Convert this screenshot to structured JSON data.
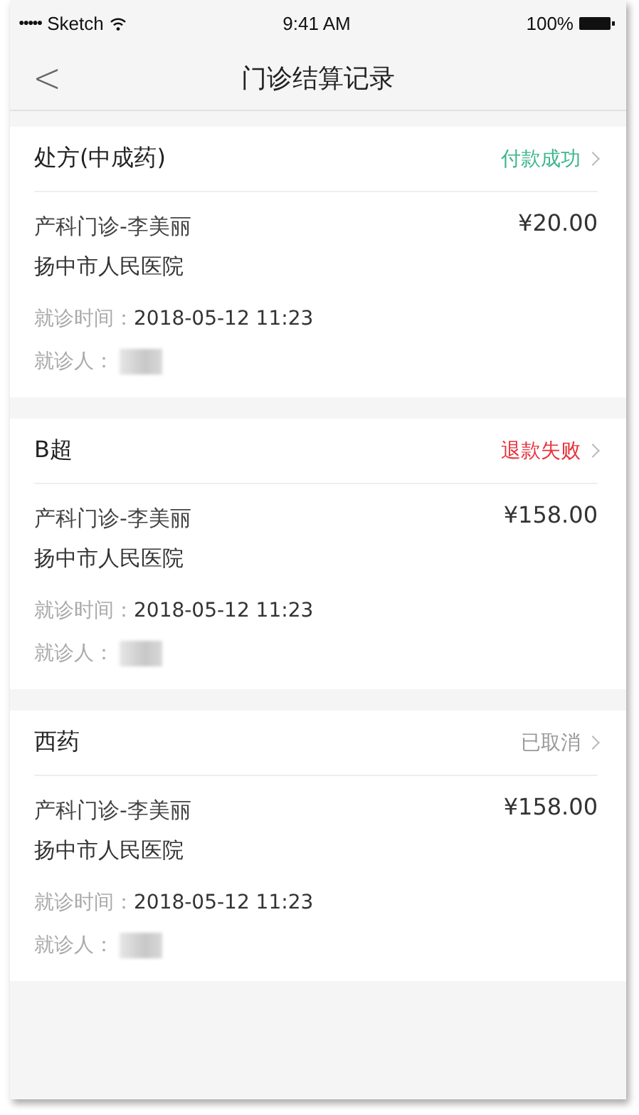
{
  "status_bar": {
    "signal": "●●●●●",
    "carrier": "Sketch",
    "time": "9:41 AM",
    "battery": "100%"
  },
  "nav": {
    "back": "<",
    "title": "门诊结算记录"
  },
  "records": [
    {
      "title": "处方(中成药)",
      "status": "付款成功",
      "kind": "success",
      "department": "产科门诊-李美丽",
      "amount": "¥20.00",
      "hospital": "扬中市人民医院",
      "time_label": "就诊时间：",
      "time": "2018-05-12 11:23",
      "patient_label": "就诊人："
    },
    {
      "title": "B超",
      "status": "退款失败",
      "kind": "failed",
      "department": "产科门诊-李美丽",
      "amount": "¥158.00",
      "hospital": "扬中市人民医院",
      "time_label": "就诊时间：",
      "time": "2018-05-12 11:23",
      "patient_label": "就诊人："
    },
    {
      "title": "西药",
      "status": "已取消",
      "kind": "cancelled",
      "department": "产科门诊-李美丽",
      "amount": "¥158.00",
      "hospital": "扬中市人民医院",
      "time_label": "就诊时间：",
      "time": "2018-05-12 11:23",
      "patient_label": "就诊人："
    }
  ]
}
